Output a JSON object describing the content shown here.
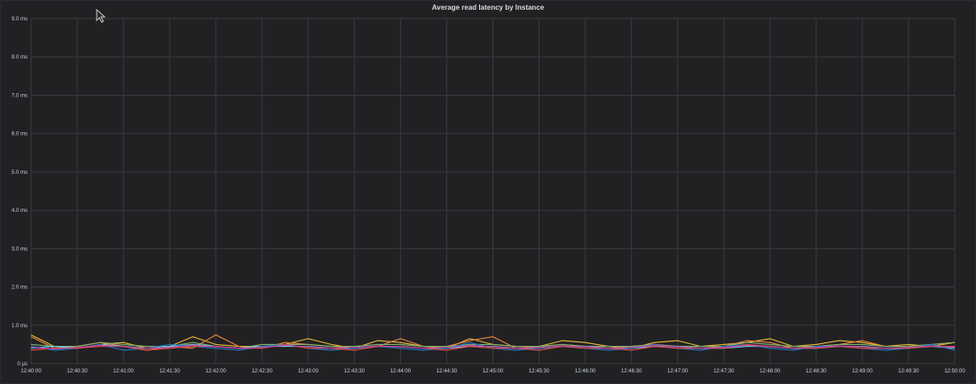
{
  "panel": {
    "title": "Average read latency by Instance"
  },
  "chart_data": {
    "type": "line",
    "title": "Average read latency by Instance",
    "xlabel": "",
    "ylabel": "",
    "ylim": [
      0,
      9
    ],
    "y_ticks": [
      "0 µs",
      "1.0 ms",
      "2.0 ms",
      "3.0 ms",
      "4.0 ms",
      "5.0 ms",
      "6.0 ms",
      "7.0 ms",
      "8.0 ms",
      "9.0 ms"
    ],
    "x_ticks": [
      "12:40:00",
      "12:40:30",
      "12:41:00",
      "12:41:30",
      "12:42:00",
      "12:42:30",
      "12:43:00",
      "12:43:30",
      "12:44:00",
      "12:44:30",
      "12:45:00",
      "12:45:30",
      "12:46:00",
      "12:46:30",
      "12:47:00",
      "12:47:30",
      "12:48:00",
      "12:48:30",
      "12:49:00",
      "12:49:30",
      "12:50:00"
    ],
    "grid": true,
    "legend": "none",
    "x": [
      "12:40:00",
      "12:40:15",
      "12:40:30",
      "12:40:45",
      "12:41:00",
      "12:41:15",
      "12:41:30",
      "12:41:45",
      "12:42:00",
      "12:42:15",
      "12:42:30",
      "12:42:45",
      "12:43:00",
      "12:43:15",
      "12:43:30",
      "12:43:45",
      "12:44:00",
      "12:44:15",
      "12:44:30",
      "12:44:45",
      "12:45:00",
      "12:45:15",
      "12:45:30",
      "12:45:45",
      "12:46:00",
      "12:46:15",
      "12:46:30",
      "12:46:45",
      "12:47:00",
      "12:47:15",
      "12:47:30",
      "12:47:45",
      "12:48:00",
      "12:48:15",
      "12:48:30",
      "12:48:45",
      "12:49:00",
      "12:49:15",
      "12:49:30",
      "12:49:45",
      "12:50:00"
    ],
    "series": [
      {
        "color": "#eab839",
        "values": [
          0.75,
          0.45,
          0.4,
          0.5,
          0.55,
          0.4,
          0.45,
          0.7,
          0.5,
          0.45,
          0.45,
          0.5,
          0.65,
          0.5,
          0.4,
          0.6,
          0.55,
          0.45,
          0.4,
          0.65,
          0.5,
          0.45,
          0.45,
          0.6,
          0.55,
          0.45,
          0.4,
          0.55,
          0.6,
          0.45,
          0.5,
          0.55,
          0.65,
          0.45,
          0.5,
          0.6,
          0.55,
          0.45,
          0.5,
          0.45,
          0.55
        ]
      },
      {
        "color": "#ef843c",
        "values": [
          0.7,
          0.4,
          0.45,
          0.55,
          0.45,
          0.35,
          0.45,
          0.4,
          0.75,
          0.45,
          0.4,
          0.55,
          0.5,
          0.45,
          0.4,
          0.45,
          0.65,
          0.45,
          0.45,
          0.6,
          0.7,
          0.4,
          0.45,
          0.5,
          0.45,
          0.4,
          0.45,
          0.5,
          0.45,
          0.4,
          0.45,
          0.6,
          0.55,
          0.4,
          0.45,
          0.5,
          0.6,
          0.45,
          0.45,
          0.5,
          0.55
        ]
      },
      {
        "color": "#7eb26d",
        "values": [
          0.5,
          0.45,
          0.45,
          0.55,
          0.5,
          0.45,
          0.45,
          0.55,
          0.45,
          0.4,
          0.5,
          0.5,
          0.5,
          0.45,
          0.45,
          0.5,
          0.5,
          0.45,
          0.45,
          0.5,
          0.5,
          0.45,
          0.45,
          0.5,
          0.45,
          0.45,
          0.45,
          0.5,
          0.45,
          0.45,
          0.45,
          0.55,
          0.5,
          0.45,
          0.45,
          0.5,
          0.5,
          0.45,
          0.45,
          0.5,
          0.55
        ]
      },
      {
        "color": "#6ed0e0",
        "values": [
          0.4,
          0.45,
          0.4,
          0.5,
          0.45,
          0.4,
          0.45,
          0.5,
          0.45,
          0.4,
          0.45,
          0.45,
          0.45,
          0.4,
          0.4,
          0.45,
          0.45,
          0.4,
          0.4,
          0.45,
          0.45,
          0.4,
          0.4,
          0.45,
          0.45,
          0.4,
          0.4,
          0.45,
          0.45,
          0.4,
          0.4,
          0.45,
          0.45,
          0.4,
          0.4,
          0.45,
          0.45,
          0.4,
          0.4,
          0.45,
          0.4
        ]
      },
      {
        "color": "#1f78c1",
        "values": [
          0.45,
          0.35,
          0.4,
          0.5,
          0.35,
          0.4,
          0.5,
          0.45,
          0.4,
          0.35,
          0.45,
          0.5,
          0.4,
          0.35,
          0.4,
          0.45,
          0.4,
          0.35,
          0.4,
          0.55,
          0.4,
          0.35,
          0.4,
          0.45,
          0.4,
          0.35,
          0.4,
          0.5,
          0.4,
          0.35,
          0.45,
          0.5,
          0.4,
          0.35,
          0.45,
          0.45,
          0.4,
          0.35,
          0.4,
          0.5,
          0.35
        ]
      },
      {
        "color": "#e24d42",
        "values": [
          0.35,
          0.4,
          0.4,
          0.45,
          0.45,
          0.35,
          0.4,
          0.45,
          0.45,
          0.4,
          0.4,
          0.5,
          0.4,
          0.4,
          0.35,
          0.45,
          0.45,
          0.4,
          0.35,
          0.45,
          0.4,
          0.4,
          0.35,
          0.45,
          0.4,
          0.4,
          0.35,
          0.45,
          0.4,
          0.4,
          0.4,
          0.5,
          0.45,
          0.4,
          0.4,
          0.45,
          0.4,
          0.4,
          0.4,
          0.45,
          0.45
        ]
      },
      {
        "color": "#ba43a9",
        "values": [
          0.42,
          0.38,
          0.42,
          0.48,
          0.44,
          0.4,
          0.42,
          0.48,
          0.44,
          0.4,
          0.42,
          0.48,
          0.44,
          0.4,
          0.42,
          0.46,
          0.44,
          0.4,
          0.42,
          0.48,
          0.44,
          0.4,
          0.42,
          0.46,
          0.44,
          0.4,
          0.42,
          0.48,
          0.44,
          0.4,
          0.42,
          0.48,
          0.44,
          0.4,
          0.42,
          0.46,
          0.44,
          0.4,
          0.42,
          0.46,
          0.42
        ]
      }
    ]
  }
}
